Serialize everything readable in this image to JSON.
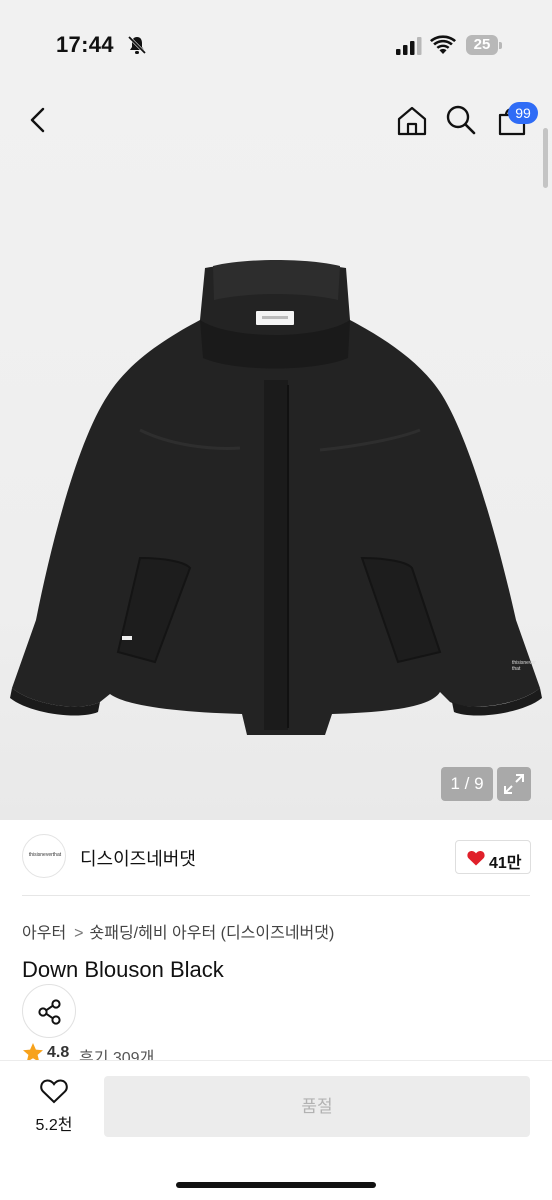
{
  "status_bar": {
    "time": "17:44",
    "battery_level": "25",
    "icons": [
      "bell-slash-icon",
      "signal-icon",
      "wifi-icon",
      "battery-icon"
    ]
  },
  "header": {
    "icons": [
      "chevron-left-icon",
      "home-icon",
      "search-icon",
      "shopping-bag-icon"
    ],
    "cart_badge": "99"
  },
  "gallery": {
    "counter": "1 / 9",
    "expand_icon": "expand-icon"
  },
  "brand": {
    "logo_text": "thisisneverthat",
    "name": "디스이즈네버댓",
    "likes": "41만",
    "like_icon": "heart-filled-icon"
  },
  "breadcrumb": {
    "items": [
      "아우터",
      "숏패딩/헤비 아우터 (디스이즈네버댓)"
    ],
    "separator": ">"
  },
  "product": {
    "title": "Down Blouson Black",
    "rating": "4.8",
    "reviews": "후기 309개"
  },
  "bottom_bar": {
    "wish_count": "5.2천",
    "buy_label": "품절"
  },
  "colors": {
    "accent_badge": "#2f6cf6",
    "heart": "#e0202a",
    "star": "#f7a21b",
    "disabled_button": "#ececec"
  }
}
